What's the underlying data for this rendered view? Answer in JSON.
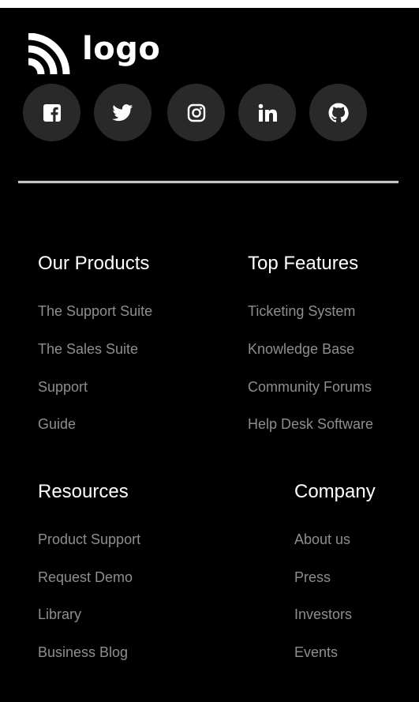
{
  "brand": {
    "logo_text": "logo",
    "logo_icon": "wifi-arcs-logo-icon"
  },
  "social": [
    {
      "name": "facebook",
      "icon": "facebook-icon"
    },
    {
      "name": "twitter",
      "icon": "twitter-icon"
    },
    {
      "name": "instagram",
      "icon": "instagram-icon"
    },
    {
      "name": "linkedin",
      "icon": "linkedin-icon"
    },
    {
      "name": "github",
      "icon": "github-icon"
    }
  ],
  "colors": {
    "background": "#000000",
    "heading": "#ffffff",
    "link": "#8e8e8e",
    "social_button": "#292929"
  },
  "columns": [
    {
      "heading": "Our Products",
      "links": [
        "The Support Suite",
        "The Sales Suite",
        "Support",
        "Guide"
      ]
    },
    {
      "heading": "Top Features",
      "links": [
        "Ticketing System",
        "Knowledge Base",
        "Community Forums",
        "Help Desk Software"
      ]
    },
    {
      "heading": "Resources",
      "links": [
        "Product Support",
        "Request Demo",
        "Library",
        "Business Blog"
      ]
    },
    {
      "heading": "Company",
      "links": [
        "About us",
        "Press",
        "Investors",
        "Events"
      ]
    }
  ]
}
